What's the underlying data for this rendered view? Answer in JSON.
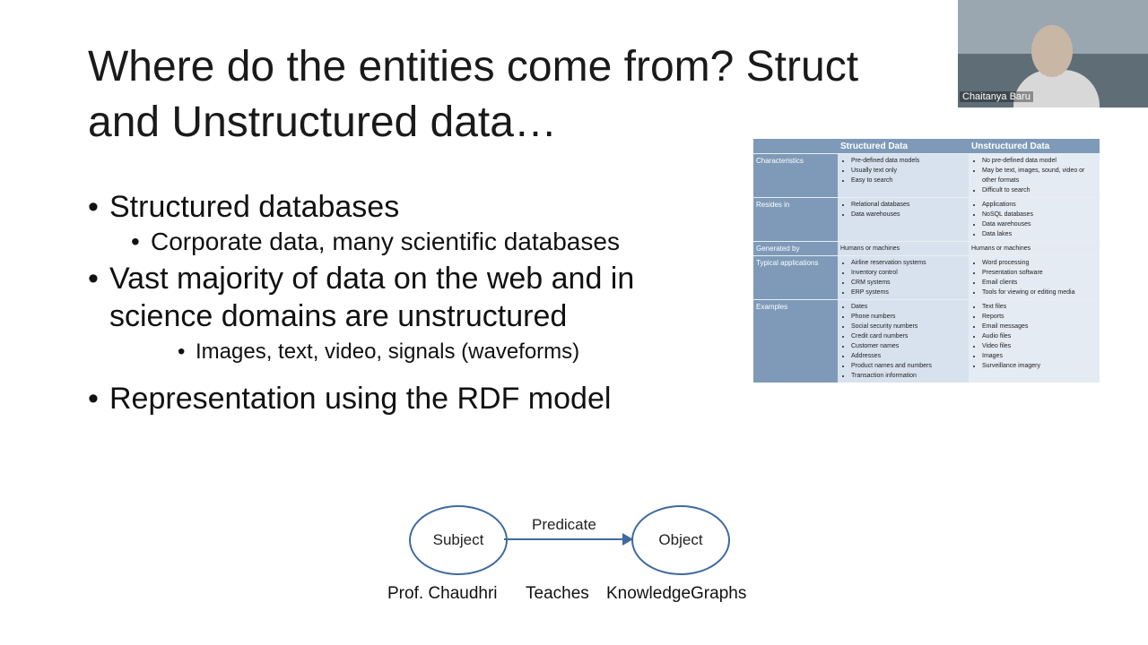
{
  "slide": {
    "title_line1": "Where do the entities come from? Struct",
    "title_line2": "and Unstructured data…",
    "bullets": {
      "b1": "Structured databases",
      "b1_sub": "Corporate data, many scientific databases",
      "b2_line1": "Vast majority of data on the web and in",
      "b2_line2": "science domains are unstructured",
      "b2_sub": "Images, text, video, signals (waveforms)",
      "b3": "Representation using the RDF model"
    }
  },
  "video": {
    "participant_name": "Chaitanya Baru"
  },
  "table": {
    "headers": [
      "",
      "Structured Data",
      "Unstructured Data"
    ],
    "rows": [
      {
        "label": "Characteristics",
        "structured": [
          "Pre-defined data models",
          "Usually text only",
          "Easy to search"
        ],
        "unstructured": [
          "No pre-defined data model",
          "May be text, images, sound, video or other formats",
          "Difficult to search"
        ]
      },
      {
        "label": "Resides in",
        "structured": [
          "Relational databases",
          "Data warehouses"
        ],
        "unstructured": [
          "Applications",
          "NoSQL databases",
          "Data warehouses",
          "Data lakes"
        ]
      },
      {
        "label": "Generated by",
        "structured_text": "Humans or machines",
        "unstructured_text": "Humans or machines"
      },
      {
        "label": "Typical applications",
        "structured": [
          "Airline reservation systems",
          "Inventory control",
          "CRM systems",
          "ERP systems"
        ],
        "unstructured": [
          "Word processing",
          "Presentation software",
          "Email clients",
          "Tools for viewing or editing media"
        ]
      },
      {
        "label": "Examples",
        "structured": [
          "Dates",
          "Phone numbers",
          "Social security numbers",
          "Credit card numbers",
          "Customer names",
          "Addresses",
          "Product names and numbers",
          "Transaction information"
        ],
        "unstructured": [
          "Text files",
          "Reports",
          "Email messages",
          "Audio files",
          "Video files",
          "Images",
          "Surveillance imagery"
        ]
      }
    ]
  },
  "rdf": {
    "subject": "Subject",
    "predicate": "Predicate",
    "object": "Object",
    "example_subject": "Prof. Chaudhri",
    "example_predicate": "Teaches",
    "example_object": "KnowledgeGraphs"
  },
  "colors": {
    "table_header": "#7e9ab8",
    "ellipse_border": "#3e6aa0"
  }
}
